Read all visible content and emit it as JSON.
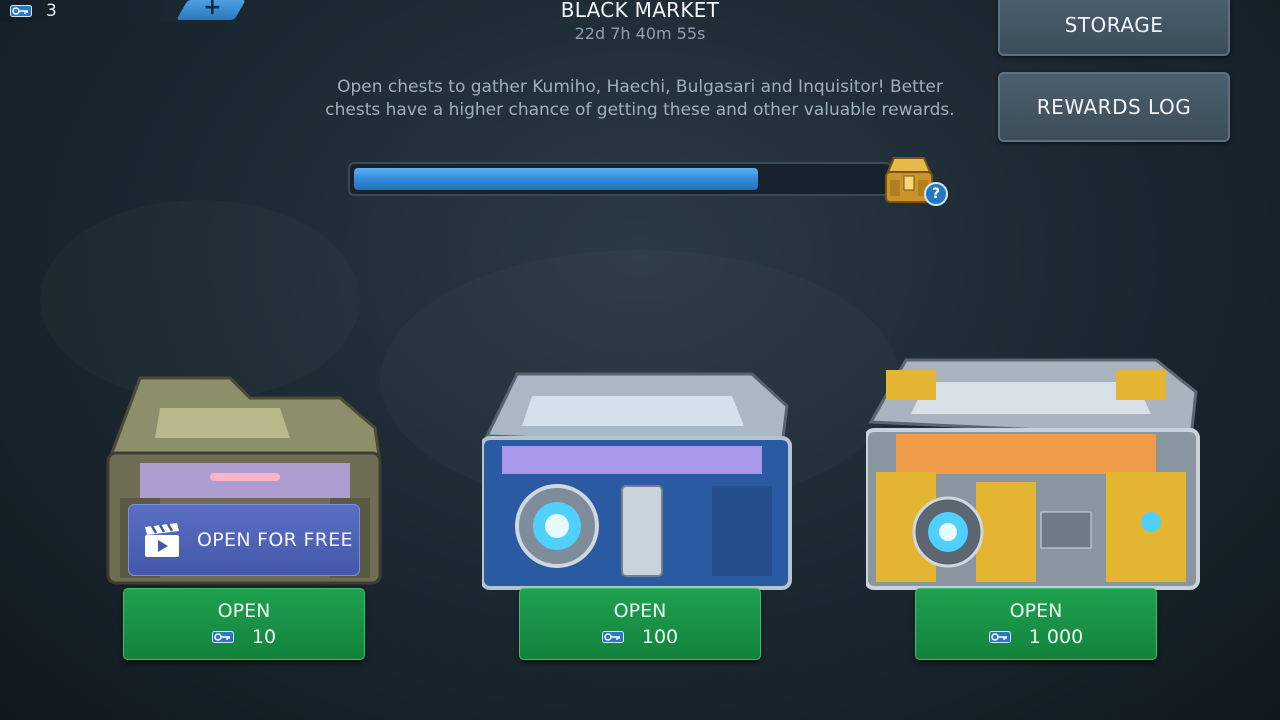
{
  "currency": {
    "icon": "key-icon",
    "amount": "3",
    "add_icon": "plus-icon"
  },
  "header": {
    "title": "BLACK MARKET",
    "timer": "22d 7h 40m 55s",
    "description": "Open chests to gather Kumiho, Haechi, Bulgasari and Inquisitor! Better chests have a higher chance of getting these and other valuable rewards."
  },
  "progress": {
    "fraction": 0.76,
    "reward_icon": "gold-chest-icon",
    "help": "?"
  },
  "side_buttons": {
    "storage": "STORAGE",
    "rewards_log": "REWARDS LOG"
  },
  "chests": [
    {
      "name": "bronze",
      "free_label": "OPEN FOR FREE",
      "open_label": "OPEN",
      "price": "10"
    },
    {
      "name": "silver",
      "open_label": "OPEN",
      "price": "100"
    },
    {
      "name": "gold",
      "open_label": "OPEN",
      "price": "1 000"
    }
  ],
  "colors": {
    "accent_blue": "#2e86d6",
    "open_green": "#1ea150",
    "free_purple": "#5a6fc4"
  }
}
